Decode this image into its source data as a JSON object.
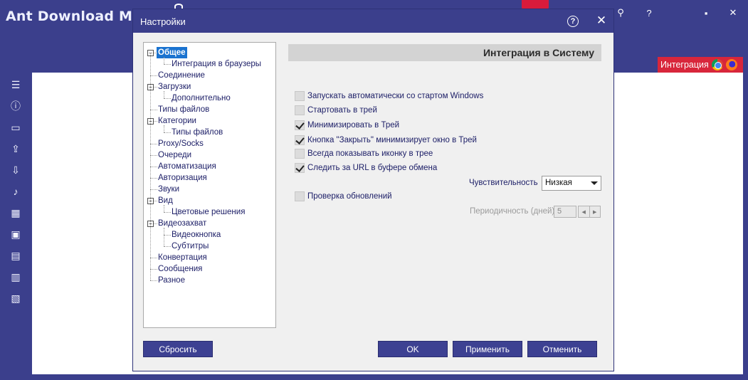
{
  "app": {
    "title": "Ant Download Mana",
    "integration_label": "Интеграция"
  },
  "dialog": {
    "title": "Настройки",
    "help_glyph": "?",
    "close_glyph": "✕",
    "panel_title": "Интеграция в Систему"
  },
  "tree": [
    {
      "label": "Общее",
      "level": 0,
      "toggle": "−",
      "selected": true
    },
    {
      "label": "Интеграция в браузеры",
      "level": 1
    },
    {
      "label": "Соединение",
      "level": 0
    },
    {
      "label": "Загрузки",
      "level": 0,
      "toggle": "−"
    },
    {
      "label": "Дополнительно",
      "level": 1
    },
    {
      "label": "Типы файлов",
      "level": 0
    },
    {
      "label": "Категории",
      "level": 0,
      "toggle": "−"
    },
    {
      "label": "Типы файлов",
      "level": 1
    },
    {
      "label": "Proxy/Socks",
      "level": 0
    },
    {
      "label": "Очереди",
      "level": 0
    },
    {
      "label": "Автоматизация",
      "level": 0
    },
    {
      "label": "Авторизация",
      "level": 0
    },
    {
      "label": "Звуки",
      "level": 0
    },
    {
      "label": "Вид",
      "level": 0,
      "toggle": "−"
    },
    {
      "label": "Цветовые решения",
      "level": 1
    },
    {
      "label": "Видеозахват",
      "level": 0,
      "toggle": "−"
    },
    {
      "label": "Видеокнопка",
      "level": 1
    },
    {
      "label": "Субтитры",
      "level": 1
    },
    {
      "label": "Конвертация",
      "level": 0
    },
    {
      "label": "Сообщения",
      "level": 0
    },
    {
      "label": "Разное",
      "level": 0
    }
  ],
  "options": {
    "autostart": {
      "label": "Запускать автоматически со стартом Windows",
      "checked": false
    },
    "start_tray": {
      "label": "Стартовать в трей",
      "checked": false
    },
    "minimize_tray": {
      "label": "Минимизировать в Трей",
      "checked": true
    },
    "close_minimizes": {
      "label": "Кнопка \"Закрыть\" минимизирует окно в Трей",
      "checked": true
    },
    "always_tray_icon": {
      "label": "Всегда показывать иконку в трее",
      "checked": false
    },
    "clipboard_watch": {
      "label": "Следить за URL в буфере обмена",
      "checked": true
    },
    "check_updates": {
      "label": "Проверка обновлений",
      "checked": false
    }
  },
  "sensitivity": {
    "label": "Чувствительность",
    "value": "Низкая"
  },
  "period": {
    "label": "Периодичность (дней)",
    "value": "5"
  },
  "buttons": {
    "reset": "Сбросить",
    "ok": "OK",
    "apply": "Применить",
    "cancel": "Отменить"
  }
}
